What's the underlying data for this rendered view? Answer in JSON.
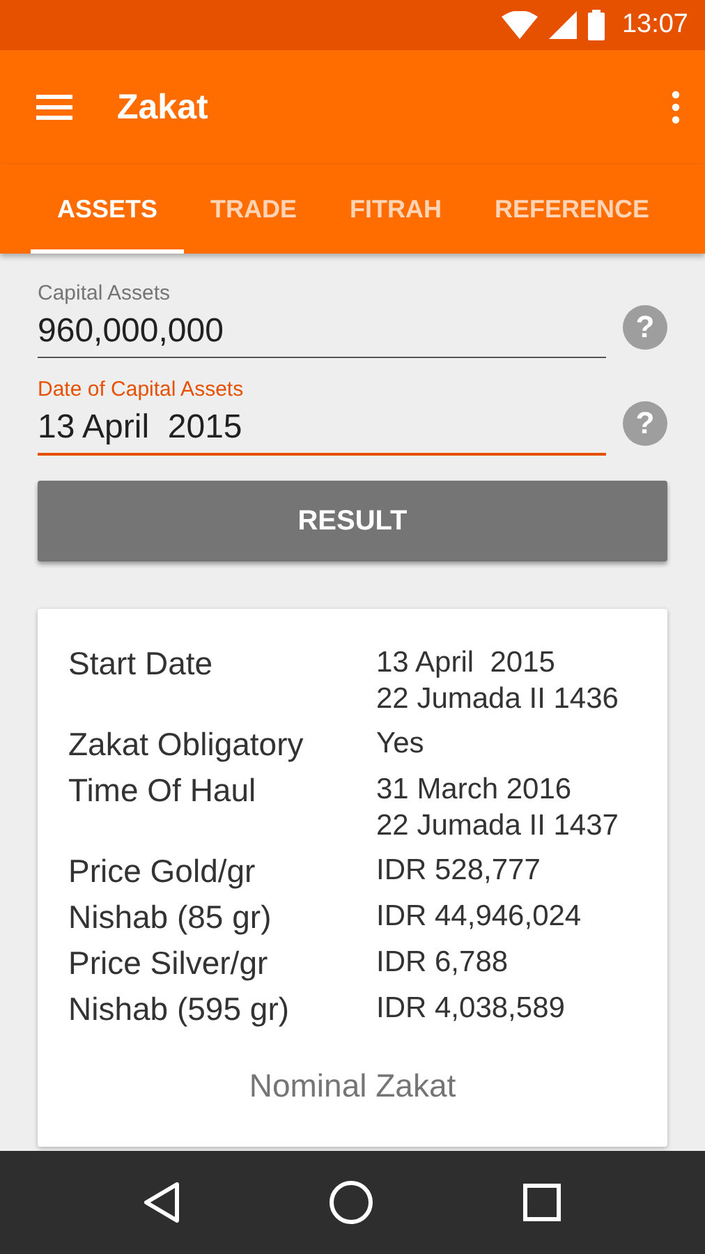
{
  "status_bar": {
    "time": "13:07"
  },
  "app_bar": {
    "title": "Zakat"
  },
  "tabs": [
    {
      "label": "ASSETS",
      "selected": true
    },
    {
      "label": "TRADE",
      "selected": false
    },
    {
      "label": "FITRAH",
      "selected": false
    },
    {
      "label": "REFERENCE",
      "selected": false
    }
  ],
  "fields": [
    {
      "label": "Capital Assets",
      "value": "960,000,000",
      "focused": false,
      "help": "?"
    },
    {
      "label": "Date of Capital Assets",
      "value": "13 April  2015",
      "focused": true,
      "help": "?"
    }
  ],
  "result_button": "RESULT",
  "result": {
    "rows": [
      {
        "label": "Start Date",
        "value": [
          "13 April  2015",
          "22 Jumada II 1436"
        ]
      },
      {
        "label": "Zakat Obligatory",
        "value": [
          "Yes"
        ]
      },
      {
        "label": "Time Of Haul",
        "value": [
          "31 March 2016",
          "22 Jumada II 1437"
        ]
      },
      {
        "label": "Price Gold/gr",
        "value": [
          "IDR 528,777"
        ]
      },
      {
        "label": "Nishab (85 gr)",
        "value": [
          "IDR 44,946,024"
        ]
      },
      {
        "label": "Price Silver/gr",
        "value": [
          "IDR 6,788"
        ]
      },
      {
        "label": "Nishab (595 gr)",
        "value": [
          "IDR 4,038,589"
        ]
      }
    ],
    "nominal_label": "Nominal Zakat"
  }
}
